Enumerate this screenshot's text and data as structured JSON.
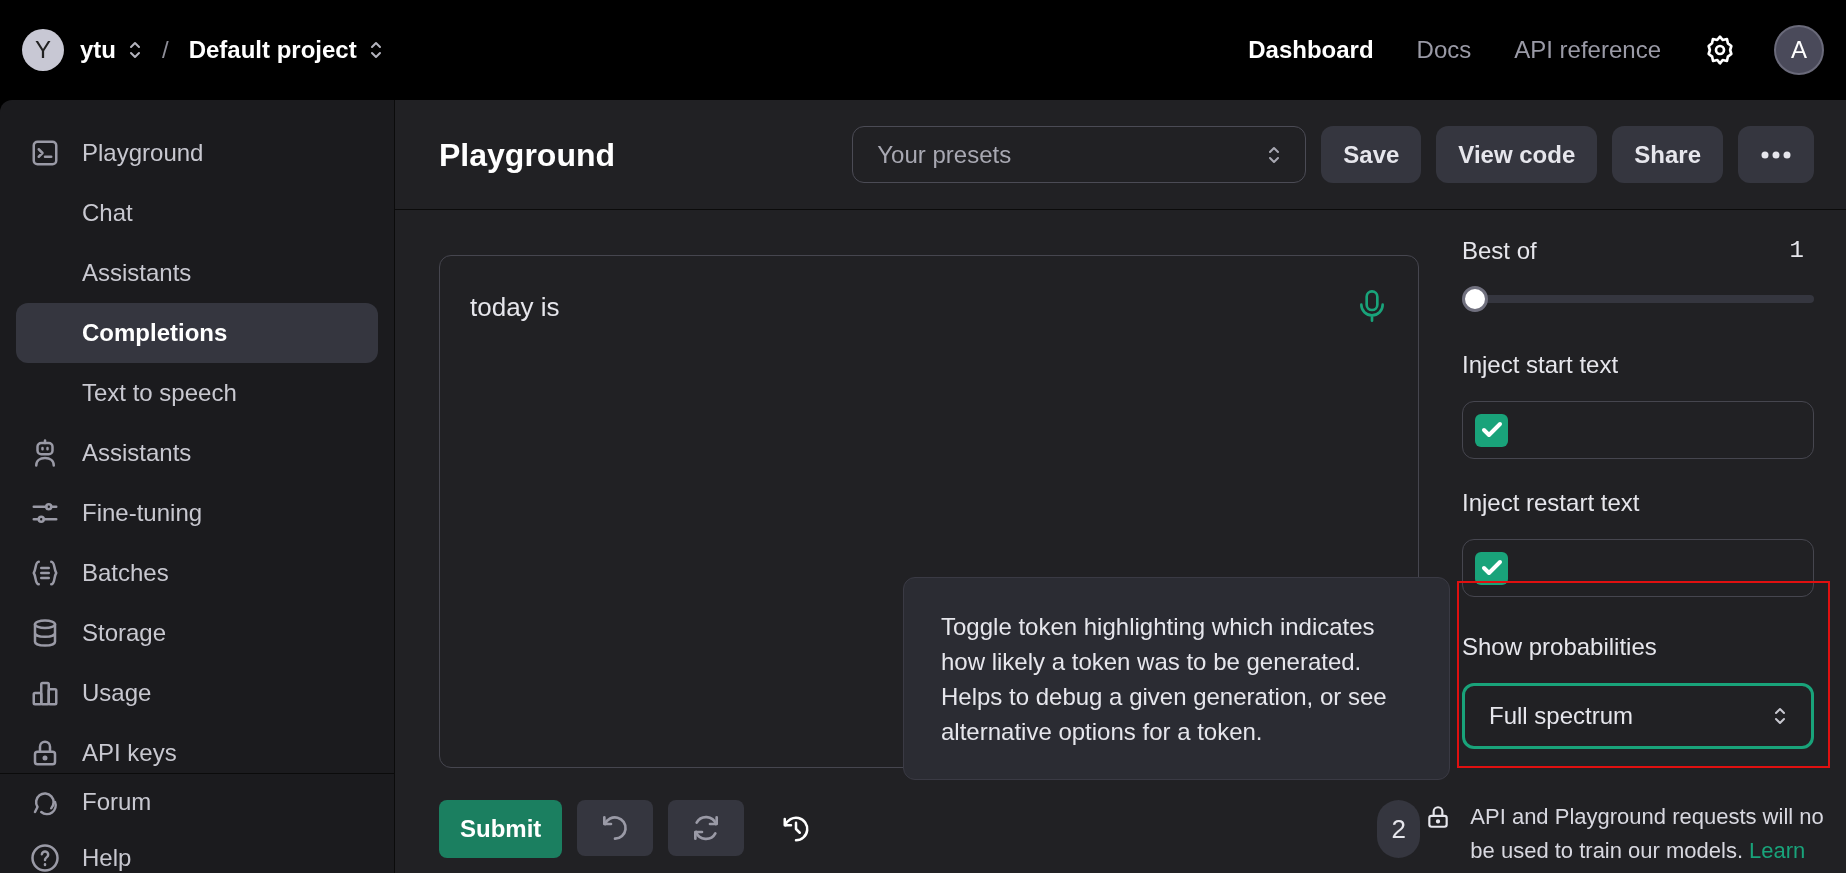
{
  "topbar": {
    "org_avatar": "Y",
    "org": "ytu",
    "separator": "/",
    "project": "Default project",
    "nav": [
      {
        "label": "Dashboard",
        "selected": true
      },
      {
        "label": "Docs",
        "selected": false
      },
      {
        "label": "API reference",
        "selected": false
      }
    ],
    "user_avatar": "A"
  },
  "sidebar": {
    "items": [
      {
        "label": "Playground",
        "selected": false,
        "children": [
          {
            "label": "Chat",
            "selected": false
          },
          {
            "label": "Assistants",
            "selected": false
          },
          {
            "label": "Completions",
            "selected": true
          },
          {
            "label": "Text to speech",
            "selected": false
          }
        ]
      },
      {
        "label": "Assistants",
        "selected": false
      },
      {
        "label": "Fine-tuning",
        "selected": false
      },
      {
        "label": "Batches",
        "selected": false
      },
      {
        "label": "Storage",
        "selected": false
      },
      {
        "label": "Usage",
        "selected": false
      },
      {
        "label": "API keys",
        "selected": false
      }
    ],
    "footer": [
      {
        "label": "Forum"
      },
      {
        "label": "Help"
      }
    ]
  },
  "header": {
    "title": "Playground",
    "presets": {
      "placeholder": "Your presets"
    },
    "buttons": [
      "Save",
      "View code",
      "Share"
    ]
  },
  "prompt": {
    "value": "today is"
  },
  "tooltip": "Toggle token highlighting which indicates how likely a token was to be generated. Helps to debug a given generation, or see alternative options for a token.",
  "settings": {
    "best_of": {
      "label": "Best of",
      "value": "1",
      "level": 0
    },
    "inject_start": {
      "label": "Inject start text",
      "checked": true
    },
    "inject_restart": {
      "label": "Inject restart text",
      "checked": true
    },
    "show_probabilities": {
      "label": "Show probabilities",
      "value": "Full spectrum"
    }
  },
  "footer": {
    "submit": "Submit",
    "badge": "2",
    "notice_lines": [
      "API and Playground requests will no",
      "be used to train our models."
    ],
    "link": "Learn"
  }
}
